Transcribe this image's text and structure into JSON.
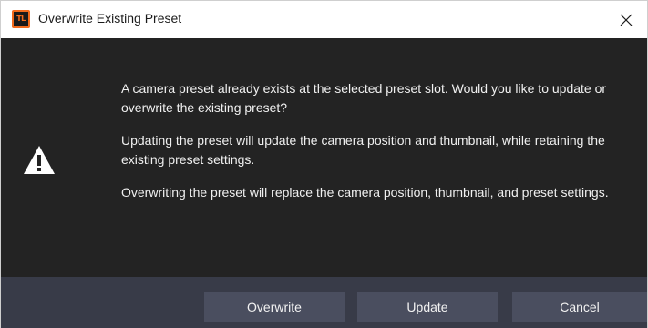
{
  "window": {
    "title": "Overwrite Existing Preset",
    "app_icon_text": "TL",
    "close_glyph": "×"
  },
  "icons": {
    "app": "app-logo-icon",
    "close": "close-icon",
    "warning": "warning-triangle-icon"
  },
  "message": {
    "paragraph1": "A camera preset already exists at the selected preset slot. Would you like to update or overwrite the existing preset?",
    "paragraph2": "Updating the preset will update the camera position and thumbnail, while retaining the existing preset settings.",
    "paragraph3": "Overwriting the preset will replace the camera position, thumbnail, and preset settings."
  },
  "buttons": {
    "overwrite": "Overwrite",
    "update": "Update",
    "cancel": "Cancel"
  },
  "colors": {
    "content_bg": "#232323",
    "footer_bg": "#383b48",
    "button_bg": "#4a4e5f",
    "app_icon_accent": "#f26b1d"
  }
}
